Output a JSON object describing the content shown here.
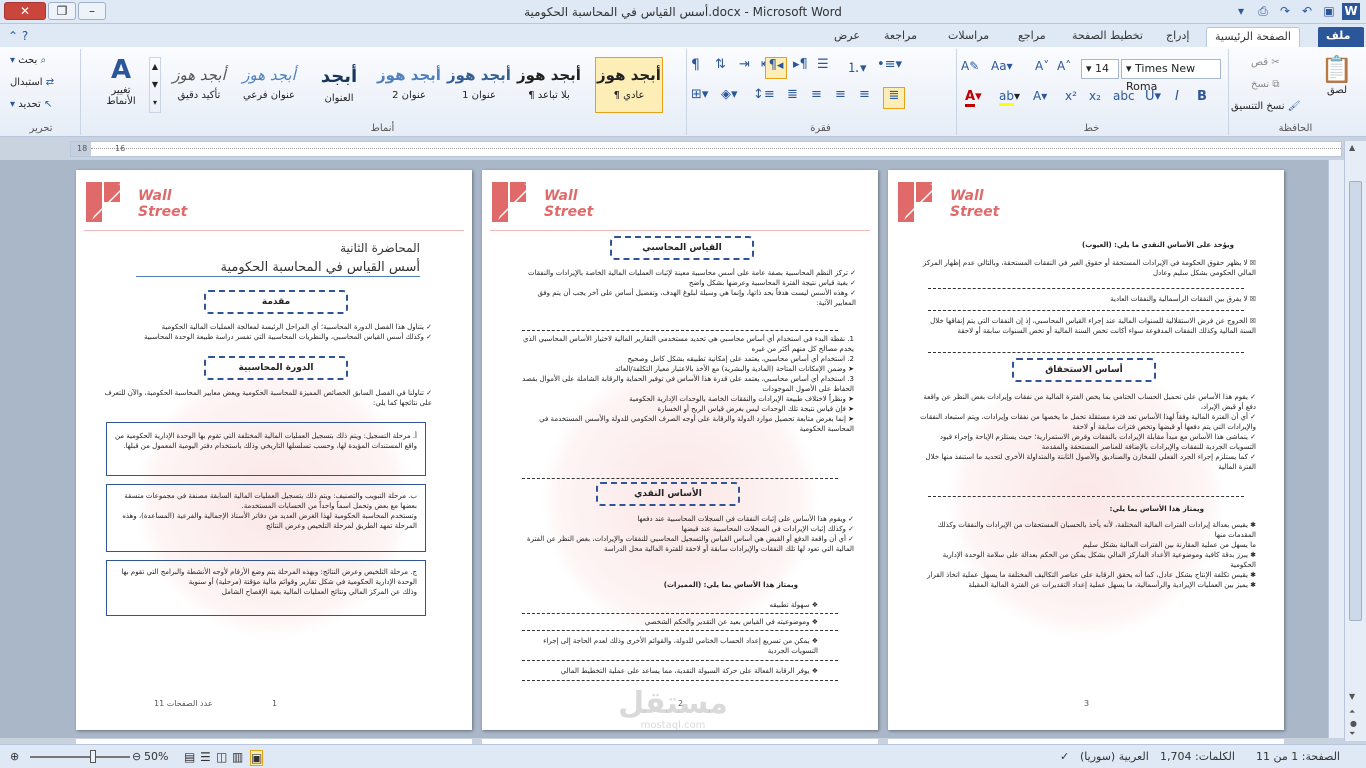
{
  "window": {
    "title": "أسس القياس في المحاسبة الحكومية.docx - Microsoft Word",
    "controls": {
      "close": "✕",
      "maximize": "❐",
      "minimize": "–"
    }
  },
  "tabs": [
    {
      "label": "ملف",
      "active": false,
      "file": true
    },
    {
      "label": "الصفحة الرئيسية",
      "active": true
    },
    {
      "label": "إدراج"
    },
    {
      "label": "تخطيط الصفحة"
    },
    {
      "label": "مراجع"
    },
    {
      "label": "مراسلات"
    },
    {
      "label": "مراجعة"
    },
    {
      "label": "عرض"
    }
  ],
  "ribbon": {
    "clipboard": {
      "label": "الحافظة",
      "paste": "لصق",
      "cut": "قص",
      "copy": "نسخ",
      "format_painter": "نسخ التنسيق"
    },
    "font": {
      "label": "خط",
      "name": "Times New Roma",
      "size": "14"
    },
    "paragraph": {
      "label": "فقرة"
    },
    "styles": {
      "label": "أنماط",
      "items": [
        {
          "sample": "أبجد هوز",
          "name": "¶ عادي",
          "selected": true
        },
        {
          "sample": "أبجد هوز",
          "name": "¶ بلا تباعد"
        },
        {
          "sample": "أبجد هوز",
          "name": "عنوان 1"
        },
        {
          "sample": "أبجد هوز",
          "name": "عنوان 2"
        },
        {
          "sample": "أبجد",
          "name": "العنوان"
        },
        {
          "sample": "أبجد هوز",
          "name": "عنوان فرعي"
        },
        {
          "sample": "أبجد هوز",
          "name": "تأكيد دقيق"
        }
      ],
      "change_styles": "تغيير الأنماط"
    },
    "editing": {
      "label": "تحرير",
      "find": "بحث",
      "replace": "استبدال",
      "select": "تحديد"
    }
  },
  "ruler": {
    "left_mark": "18",
    "tick2": "16"
  },
  "pages": {
    "page1": {
      "logo_line1": "Wall",
      "logo_line2": "Street",
      "lecture": "المحاضرة الثانية",
      "title": "أسس القياس في المحاسبة الحكومية",
      "intro_heading": "مقدمة",
      "intro_text": "✓ يتناول هذا الفصل الدورة المحاسبية؛ أي المراحل الرئيسة لمعالجة العمليات المالية الحكومية\n✓ وكذلك أسس القياس المحاسبي، والنظريات المحاسبية التي تفسر دراسة طبيعة الوحدة المحاسبية",
      "cycle_heading": "الدورة المحاسبية",
      "cycle_text": "✓ تناولنا في الفصل السابق الخصائص المميزة للمحاسبة الحكومية ويعض معايير المحاسبة الحكومية، والآن للتعرف على نتائجها كما يلي:",
      "box1": "أ. مرحلة التسجيل: ويتم ذلك بتسجيل العمليات المالية المختلفة التي تقوم بها الوحدة الإدارية الحكومية من واقع المستندات المؤيدة لها، وحسب تسلسلها التاريخي وذلك باستخدام دفتر اليومية المعمول من قبلها.",
      "box2": "ب. مرحلة التبويب والتصنيف: ويتم ذلك بتسجيل العمليات المالية السابقة مصنفة في مجموعات متسقة بعضها مع بعض وتحمل اسماً واحداً من الحسابات المستخدمة.\nوتستخدم المحاسبة الحكومية لهذا الغرض العديد من دفاتر الأستاذ الإجمالية والفرعية (المساعدة)، وهذه المرحلة تمهد الطريق لمرحلة التلخيص وعرض النتائج",
      "box3": "ج. مرحلة التلخيص وعرض النتائج: وبهذه المرحلة يتم وضع الأرقام لأوجه الأنشطة والبرامج التي تقوم بها الوحدة الإدارية الحكومية في شكل تقارير وقوائم مالية مؤقتة (مرحلية) أو سنوية\nوذلك عن المركز المالي ونتائج العمليات المالية بغية الإفصاح الشامل",
      "number": "1",
      "footer_note": "عدد الصفحات 11"
    },
    "page2": {
      "logo_line1": "Wall",
      "logo_line2": "Street",
      "heading1": "القياس المحاسبي",
      "text1": "✓ تركز النظم المحاسبية بصفة عامة على أسس محاسبية معينة لإثبات العمليات المالية الخاصة بالإيرادات والنفقات\n✓ بغية قياس نتيجة الفترة المحاسبية وعرضها بشكل واضح\n✓ وهذه الأسس ليست هدفاً بحد ذاتها، وإنما هي وسيلة لبلوغ الهدف، وتفضيل أساس على آخر يجب أن يتم وفق المعايير الآتية:",
      "list": "1. نقطة البدء في استخدام أي أساس محاسبي هي تحديد مستخدمي التقارير المالية لاختيار الأساس المحاسبي الذي يخدم مصالح كل منهم أكثر من غيره\n2. استخدام أي أساس محاسبي، يعتمد على إمكانية تطبيقه بشكل كامل وصحيح\n➤ وضمن الإمكانات المتاحة (المادية والبشرية) مع الأخذ بالاعتبار معيار التكلفة/العائد\n3. استخدام أي أساس محاسبي، يعتمد على قدرة هذا الأساس في توفير الحماية والرقابة الشاملة على الأموال بقصد الحفاظ على الأصول الموجودات\n➤ ونظراً لاختلاف طبيعة الإيرادات والنفقات الخاصة بالوحدات الإدارية الحكومية\n➤ فإن قياس نتيجة تلك الوحدات ليس بغرض قياس الربح أو الخسارة\n➤ إنما بغرض متابعة تحصيل موارد الدولة والرقابة على أوجه الصرف الحكومي للدولة والأسس المستخدمة في المحاسبة الحكومية",
      "heading2": "الأساس النقدي",
      "text2": "✓ ويقوم هذا الأساس على إثبات النفقات في السجلات المحاسبية عند دفعها\n✓ وكذلك إثبات الإيرادات في السجلات المحاسبية عند قبضها\n✓ أي أن واقعة الدفع أو القبض هي أساس القياس والتسجيل المحاسبي للنفقات والإيرادات، بغض النظر عن الفترة المالية التي تعود لها تلك النفقات والإيرادات سابقة أو لاحقة للفترة المالية محل الدراسة",
      "adv_title": "ويمتاز هذا الأساس بما يلي: (المميزات)",
      "adv1": "❖ سهولة تطبيقه",
      "adv2": "❖ وموضوعيته في القياس بعيد عن التقدير والحكم الشخصي",
      "adv3": "❖ يمكن من تسريع إعداد الحساب الختامي للدولة، والقوائم الأخرى وذلك لعدم الحاجة إلى إجراء التسويات الجردية",
      "adv4": "❖ يوفر الرقابة الفعالة على حركة السيولة النقدية، مما يساعد على عملية التخطيط المالي",
      "number": "2"
    },
    "page3": {
      "logo_line1": "Wall",
      "logo_line2": "Street",
      "dis_title": "ويؤخذ على الأساس النقدي ما يلي: (العيوب)",
      "dis1": "☒ لا يظهر حقوق الحكومة في الإيرادات المستحقة أو حقوق الغير في النفقات المستحقة، وبالتالي عدم إظهار المركز المالي الحكومي بشكل سليم وعادل",
      "dis2": "☒ لا يفرق بين النفقات الرأسمالية والنفقات العادية",
      "dis3": "☒ الخروج عن فرض الاستقلالية للسنوات المالية عند إجراء القياس المحاسبي، إذ إن النفقات التي يتم إنفاقها خلال السنة المالية وكذلك النفقات المدفوعة سواء أكانت تخص السنة المالية أو تخص السنوات سابقة أو لاحقة",
      "heading": "أساس الاستحقاق",
      "text1": "✓ يقوم هذا الأساس على تحميل الحساب الختامي بما يخص الفترة المالية من نفقات وإيرادات بغض النظر عن واقعة دفع أو قبض الإيراد،\n✓ أي أن الفترة المالية وفقاً لهذا الأساس تعد فترة مستقلة تحمل ما يخصها من نفقات وإيرادات، ويتم استبعاد النفقات والإيرادات التي يتم دفعها أو قبضها وتخص فترات سابقة أو لاحقة\n✓ يتماشى هذا الأساس مع مبدأ مقابلة الإيرادات بالنفقات وفرض الاستمرارية؛ حيث يستلزم الإباحة وإجراء قيود التسويات الجردية للنفقات والإيرادات بالإضافة للعناصر المستحقة والمقدمة\n✓ كما يستلزم إجراء الجرد الفعلي للمخازن والصناديق والأصول الثابتة والمتداولة الأخرى لتحديد ما استنفذ منها خلال الفترة المالية",
      "adv_title": "ويمتاز هذا الأساس بما يلي:",
      "text2": "✱ يقيس بعدالة إيرادات الفترات المالية المختلفة، لأنه يأخذ بالحسبان المستحقات من الإيرادات والنفقات وكذلك المقدمات منها\nما يسهل من عملية المقارنة بين الفترات المالية بشكل سليم\n✱ يبرز بدقة كافية وموضوعية الأعداد الماركز المالي بشكل يمكن من الحكم بعدالة على سلامة الوحدة الإدارية الحكومية\n✱ يقيس تكلفة الإنتاج بشكل عادل، كما أنه يحقق الرقابة على عناصر التكاليف المختلفة ما يسهل عملية اتخاذ القرار\n✱ يميز بين العمليات الإيرادية والرأسمالية، ما يسهل عملية إعداد التقديرات عن الفترة المالية المقبلة",
      "number": "3"
    }
  },
  "status": {
    "page": "الصفحة: 1 من 11",
    "words": "الكلمات: 1,704",
    "language": "العربية (سوريا)",
    "zoom": "50%"
  },
  "watermark": {
    "text": "مستقل",
    "sub": "mostaql.com"
  },
  "colors": {
    "accent": "#2b579a",
    "logo": "#e06a6a",
    "box_border": "#2f5597"
  }
}
